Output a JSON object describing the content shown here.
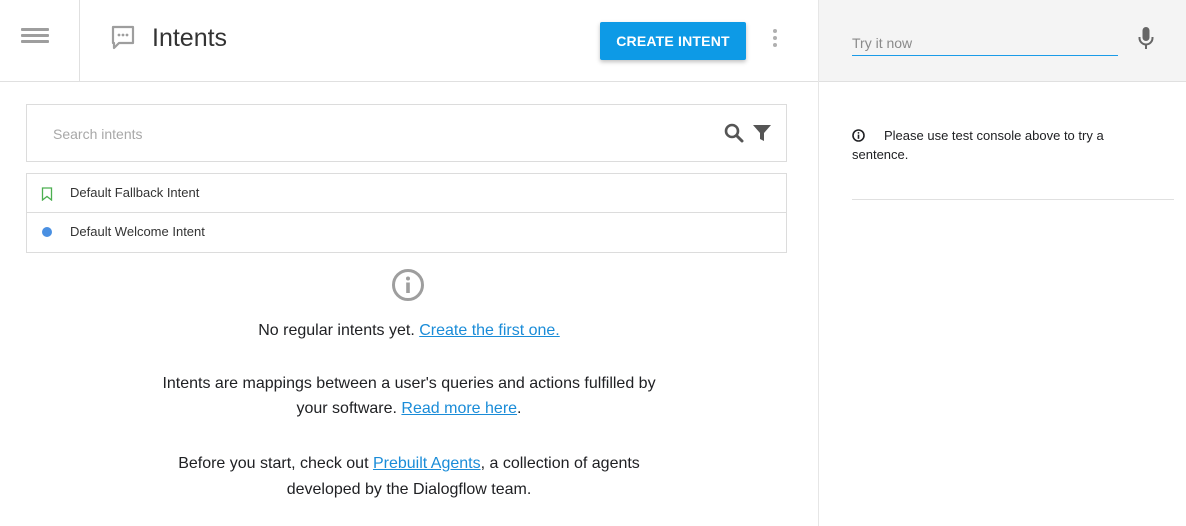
{
  "header": {
    "title": "Intents",
    "create_button_label": "CREATE INTENT"
  },
  "search": {
    "placeholder": "Search intents"
  },
  "intents": [
    {
      "label": "Default Fallback Intent",
      "icon": "bookmark-outline-icon",
      "icon_color": "#4caf50"
    },
    {
      "label": "Default Welcome Intent",
      "icon": "dot-icon",
      "icon_color": "#4a90e2"
    }
  ],
  "empty_state": {
    "line1_text": "No regular intents yet.",
    "line1_link": "Create the first one.",
    "line2_text": "Intents are mappings between a user's queries and actions fulfilled by",
    "line3_text": "your software.",
    "line3_link": "Read more here",
    "line3_suffix": ".",
    "line4_text": "Before you start, check out",
    "line4_link": "Prebuilt Agents",
    "line4_suffix": ", a collection of agents",
    "line5_text": "developed by the Dialogflow team."
  },
  "test_console": {
    "placeholder": "Try it now",
    "message": "Please use test console above to try a sentence."
  },
  "colors": {
    "accent": "#0d9ae6",
    "link": "#1a8cd8",
    "icon_gray": "#9e9e9e"
  }
}
